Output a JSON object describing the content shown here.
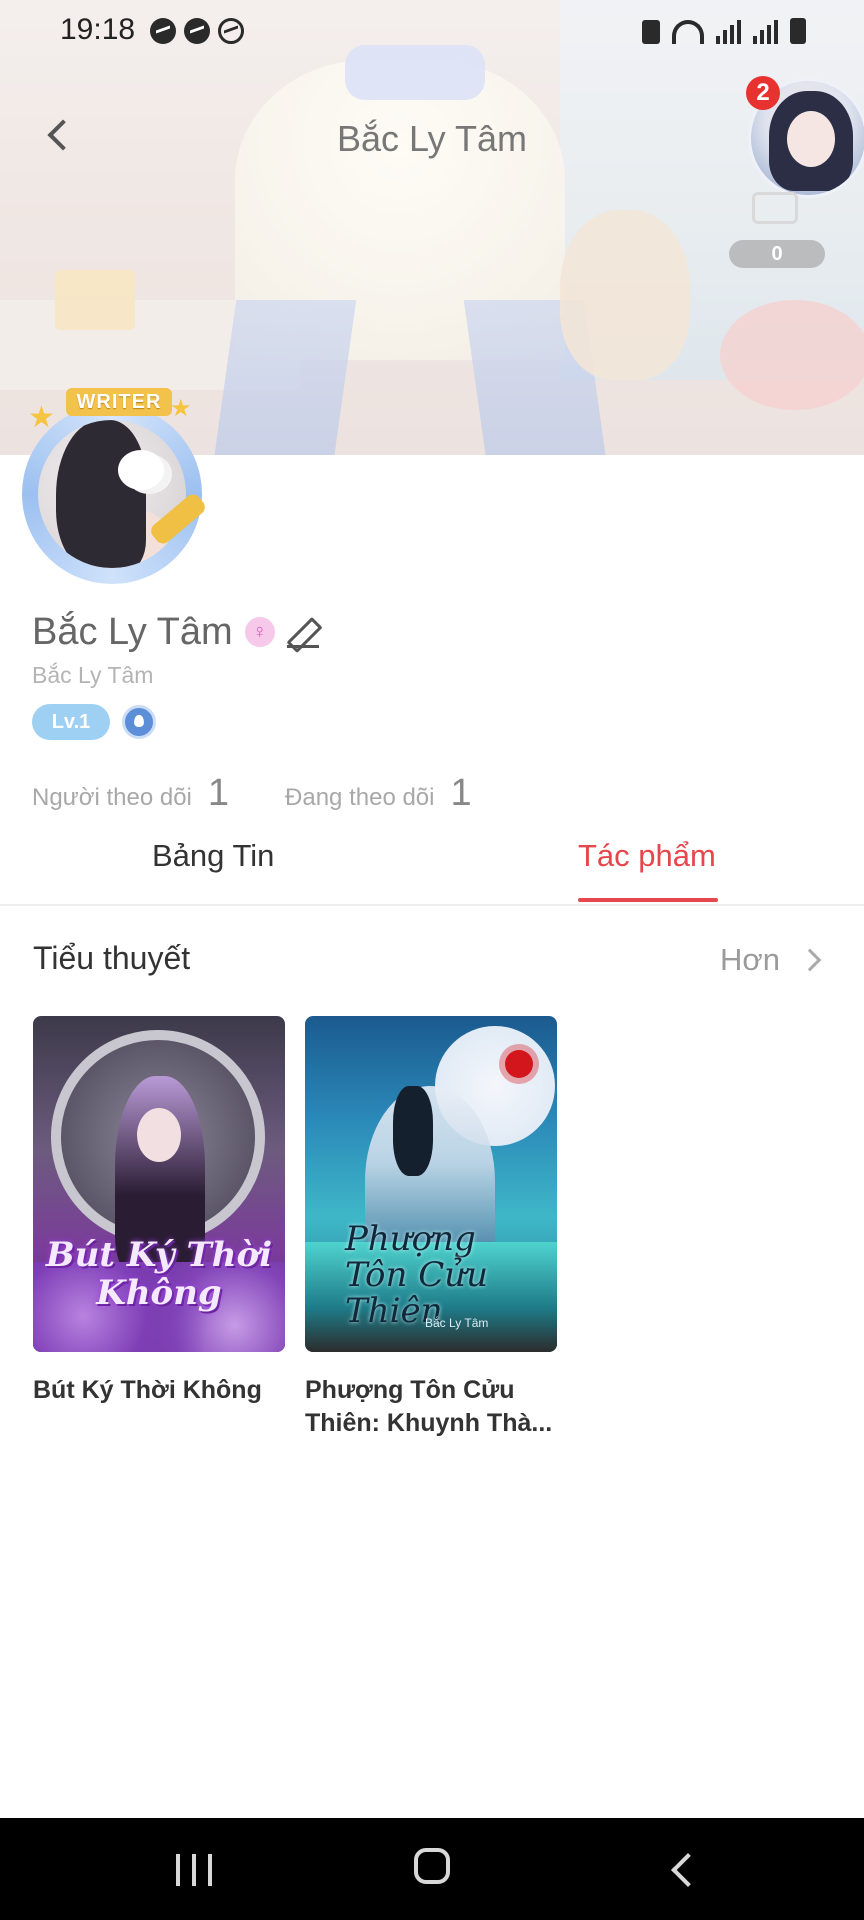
{
  "status_bar": {
    "time": "19:18",
    "icons": [
      "messenger-icon",
      "messenger-icon",
      "messenger-outline-icon",
      "battery-saver-icon",
      "wifi-icon",
      "signal-icon",
      "signal-icon",
      "battery-icon"
    ]
  },
  "header": {
    "title": "Bắc Ly Tâm",
    "notification_count": "2",
    "like_count": "0"
  },
  "profile": {
    "badge_label": "WRITER",
    "name": "Bắc Ly Tâm",
    "id_text": "Bắc Ly Tâm",
    "level": "Lv.1",
    "followers_label": "Người theo dõi",
    "followers_count": "1",
    "following_label": "Đang theo dõi",
    "following_count": "1"
  },
  "tabs": [
    {
      "label": "Bảng Tin",
      "active": false
    },
    {
      "label": "Tác phẩm",
      "active": true
    }
  ],
  "novels": {
    "section_title": "Tiểu thuyết",
    "more_label": "Hơn",
    "books": [
      {
        "title": "Bút Ký Thời Không",
        "cover_text": "Bút Ký Thời Không"
      },
      {
        "title": "Phượng Tôn Cửu Thiên: Khuynh Thà...",
        "cover_text": "Phượng Tôn Cửu Thiên",
        "cover_author": "Bắc Ly Tâm"
      }
    ]
  },
  "colors": {
    "accent": "#e5474d",
    "level_badge": "#9ed0f4",
    "notification_badge": "#e8322f"
  }
}
